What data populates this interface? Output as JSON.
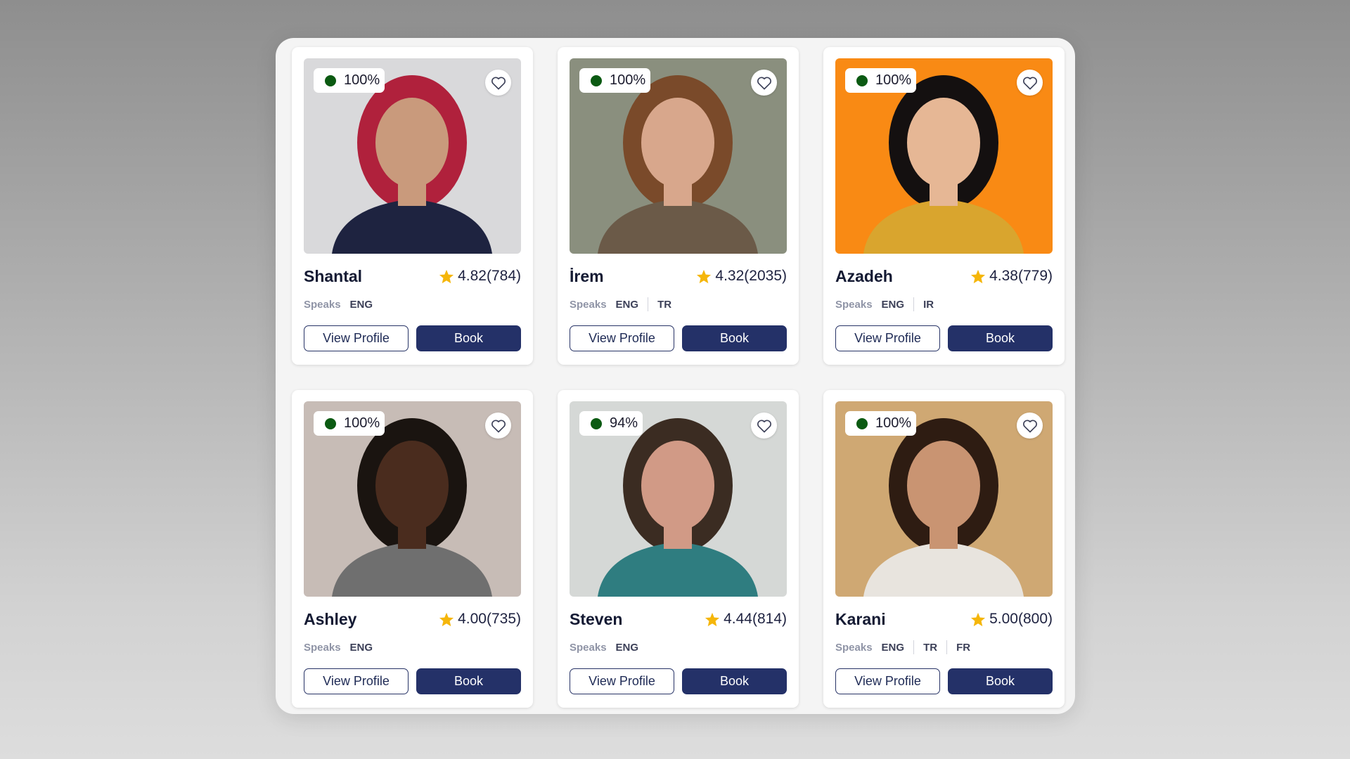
{
  "colors": {
    "online_dot": "#0b5a12",
    "star": "#f5b60a",
    "primary_button": "#243168"
  },
  "labels": {
    "speaks": "Speaks",
    "view_profile": "View Profile",
    "book": "Book"
  },
  "tutors": [
    {
      "name": "Shantal",
      "availability": "100%",
      "rating": "4.82",
      "reviews": "(784)",
      "languages": [
        "ENG"
      ],
      "photo_bg": "#d9d9db",
      "skin": "#c99a7c",
      "hair": "#b0213c",
      "shirt": "#1e2340"
    },
    {
      "name": "İrem",
      "availability": "100%",
      "rating": "4.32",
      "reviews": "(2035)",
      "languages": [
        "ENG",
        "TR"
      ],
      "photo_bg": "#8a8f7e",
      "skin": "#d8a78c",
      "hair": "#7a4a2a",
      "shirt": "#6b5a48"
    },
    {
      "name": "Azadeh",
      "availability": "100%",
      "rating": "4.38",
      "reviews": "(779)",
      "languages": [
        "ENG",
        "IR"
      ],
      "photo_bg": "#f98a14",
      "skin": "#e6b795",
      "hair": "#141010",
      "shirt": "#d9a52e"
    },
    {
      "name": "Ashley",
      "availability": "100%",
      "rating": "4.00",
      "reviews": "(735)",
      "languages": [
        "ENG"
      ],
      "photo_bg": "#c7bcb6",
      "skin": "#4a2c1e",
      "hair": "#1a1410",
      "shirt": "#6f6f6f"
    },
    {
      "name": "Steven",
      "availability": "94%",
      "rating": "4.44",
      "reviews": "(814)",
      "languages": [
        "ENG"
      ],
      "photo_bg": "#d5d8d6",
      "skin": "#d19a86",
      "hair": "#3b2c22",
      "shirt": "#2f7d80"
    },
    {
      "name": "Karani",
      "availability": "100%",
      "rating": "5.00",
      "reviews": "(800)",
      "languages": [
        "ENG",
        "TR",
        "FR"
      ],
      "photo_bg": "#cfa873",
      "skin": "#c99472",
      "hair": "#2e1c12",
      "shirt": "#e8e4de"
    }
  ]
}
